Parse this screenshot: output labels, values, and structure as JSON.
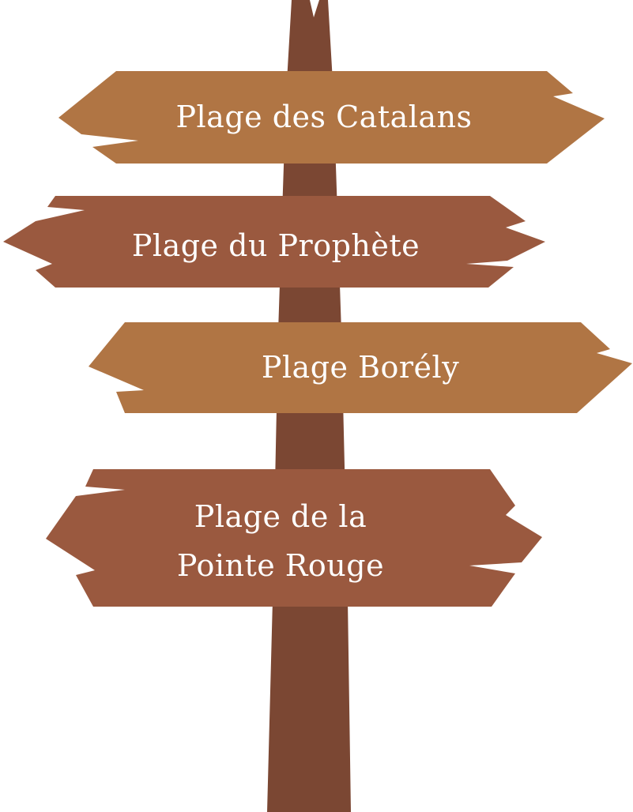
{
  "colors": {
    "background": "#ffffff",
    "post": "#7b4733",
    "sign_light": "#b07544",
    "sign_dark": "#9a593f",
    "text": "#ffffff"
  },
  "signs": [
    {
      "lines": [
        "Plage des Catalans"
      ],
      "direction": "both",
      "color": "sign_light"
    },
    {
      "lines": [
        "Plage du Prophète"
      ],
      "direction": "both",
      "color": "sign_dark"
    },
    {
      "lines": [
        "Plage Borély"
      ],
      "direction": "both",
      "color": "sign_light"
    },
    {
      "lines": [
        "Plage de la",
        "Pointe Rouge"
      ],
      "direction": "both",
      "color": "sign_dark"
    }
  ]
}
